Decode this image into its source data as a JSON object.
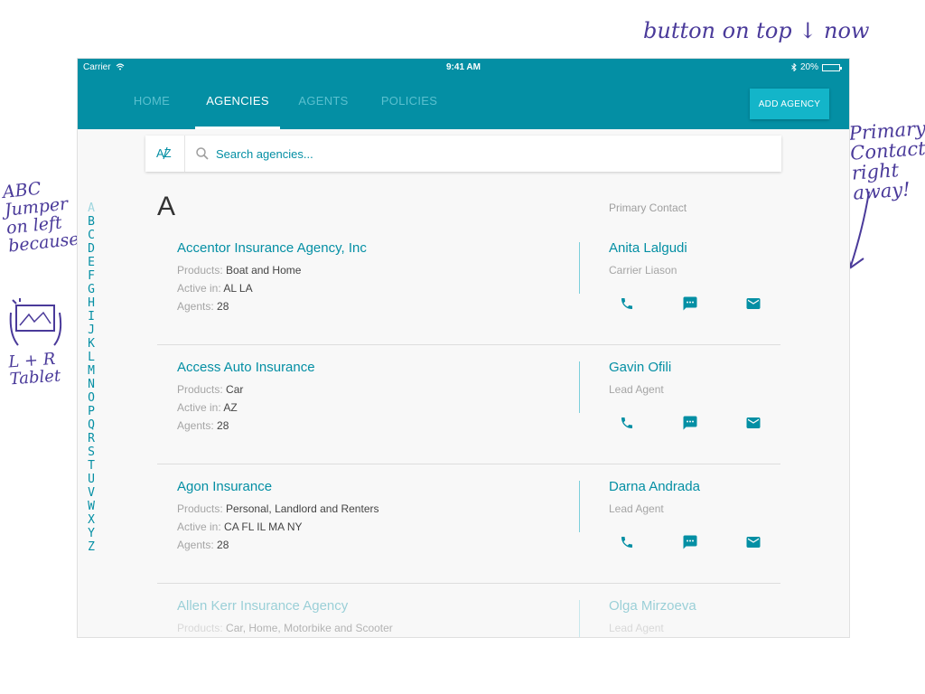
{
  "annotations": {
    "top": "button on top ↓ now",
    "right": "Primary Contact right away!",
    "left": "ABC Jumper on left because",
    "left_tablet": "L + R Tablet"
  },
  "status_bar": {
    "carrier": "Carrier",
    "time": "9:41 AM",
    "battery": "20%"
  },
  "nav": {
    "tabs": [
      {
        "label": "HOME",
        "active": false
      },
      {
        "label": "AGENCIES",
        "active": true
      },
      {
        "label": "AGENTS",
        "active": false
      },
      {
        "label": "POLICIES",
        "active": false
      }
    ],
    "add_button": "ADD AGENCY"
  },
  "search": {
    "sort_label": "A̸Z",
    "placeholder": "Search agencies..."
  },
  "jumper": [
    "A",
    "B",
    "C",
    "D",
    "E",
    "F",
    "G",
    "H",
    "I",
    "J",
    "K",
    "L",
    "M",
    "N",
    "O",
    "P",
    "Q",
    "R",
    "S",
    "T",
    "U",
    "V",
    "W",
    "X",
    "Y",
    "Z"
  ],
  "list": {
    "section_letter": "A",
    "primary_contact_label": "Primary Contact",
    "labels": {
      "products": "Products:",
      "active_in": "Active in:",
      "agents": "Agents:"
    },
    "agencies": [
      {
        "name": "Accentor Insurance Agency, Inc",
        "products": "Boat and Home",
        "active_in": "AL  LA",
        "agents": "28",
        "contact_name": "Anita Lalgudi",
        "contact_role": "Carrier Liason"
      },
      {
        "name": "Access Auto Insurance",
        "products": "Car",
        "active_in": "AZ",
        "agents": "28",
        "contact_name": "Gavin Ofili",
        "contact_role": "Lead Agent"
      },
      {
        "name": "Agon Insurance",
        "products": "Personal, Landlord and Renters",
        "active_in": "CA  FL IL  MA  NY",
        "agents": "28",
        "contact_name": "Darna Andrada",
        "contact_role": "Lead Agent"
      },
      {
        "name": "Allen Kerr Insurance Agency",
        "products": "Car, Home, Motorbike and Scooter",
        "active_in": "",
        "agents": "",
        "contact_name": "Olga Mirzoeva",
        "contact_role": "Lead Agent"
      }
    ]
  },
  "colors": {
    "brand": "#048fa4",
    "button": "#13b5c9",
    "annotation": "#4a3a9a"
  }
}
